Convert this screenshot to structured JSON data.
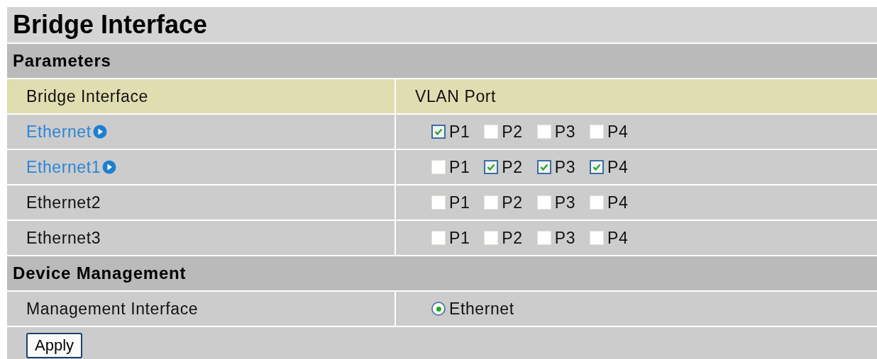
{
  "title": "Bridge Interface",
  "parameters": {
    "heading": "Parameters",
    "columns": [
      "Bridge Interface",
      "VLAN Port"
    ],
    "rows": [
      {
        "name": "Ethernet",
        "link": true,
        "ports": [
          {
            "label": "P1",
            "checked": true
          },
          {
            "label": "P2",
            "checked": false
          },
          {
            "label": "P3",
            "checked": false
          },
          {
            "label": "P4",
            "checked": false
          }
        ]
      },
      {
        "name": "Ethernet1",
        "link": true,
        "ports": [
          {
            "label": "P1",
            "checked": false
          },
          {
            "label": "P2",
            "checked": true
          },
          {
            "label": "P3",
            "checked": true
          },
          {
            "label": "P4",
            "checked": true
          }
        ]
      },
      {
        "name": "Ethernet2",
        "link": false,
        "ports": [
          {
            "label": "P1",
            "checked": false
          },
          {
            "label": "P2",
            "checked": false
          },
          {
            "label": "P3",
            "checked": false
          },
          {
            "label": "P4",
            "checked": false
          }
        ]
      },
      {
        "name": "Ethernet3",
        "link": false,
        "ports": [
          {
            "label": "P1",
            "checked": false
          },
          {
            "label": "P2",
            "checked": false
          },
          {
            "label": "P3",
            "checked": false
          },
          {
            "label": "P4",
            "checked": false
          }
        ]
      }
    ]
  },
  "device_management": {
    "heading": "Device Management",
    "label": "Management Interface",
    "options": [
      {
        "label": "Ethernet",
        "selected": true
      }
    ]
  },
  "apply_button": "Apply"
}
